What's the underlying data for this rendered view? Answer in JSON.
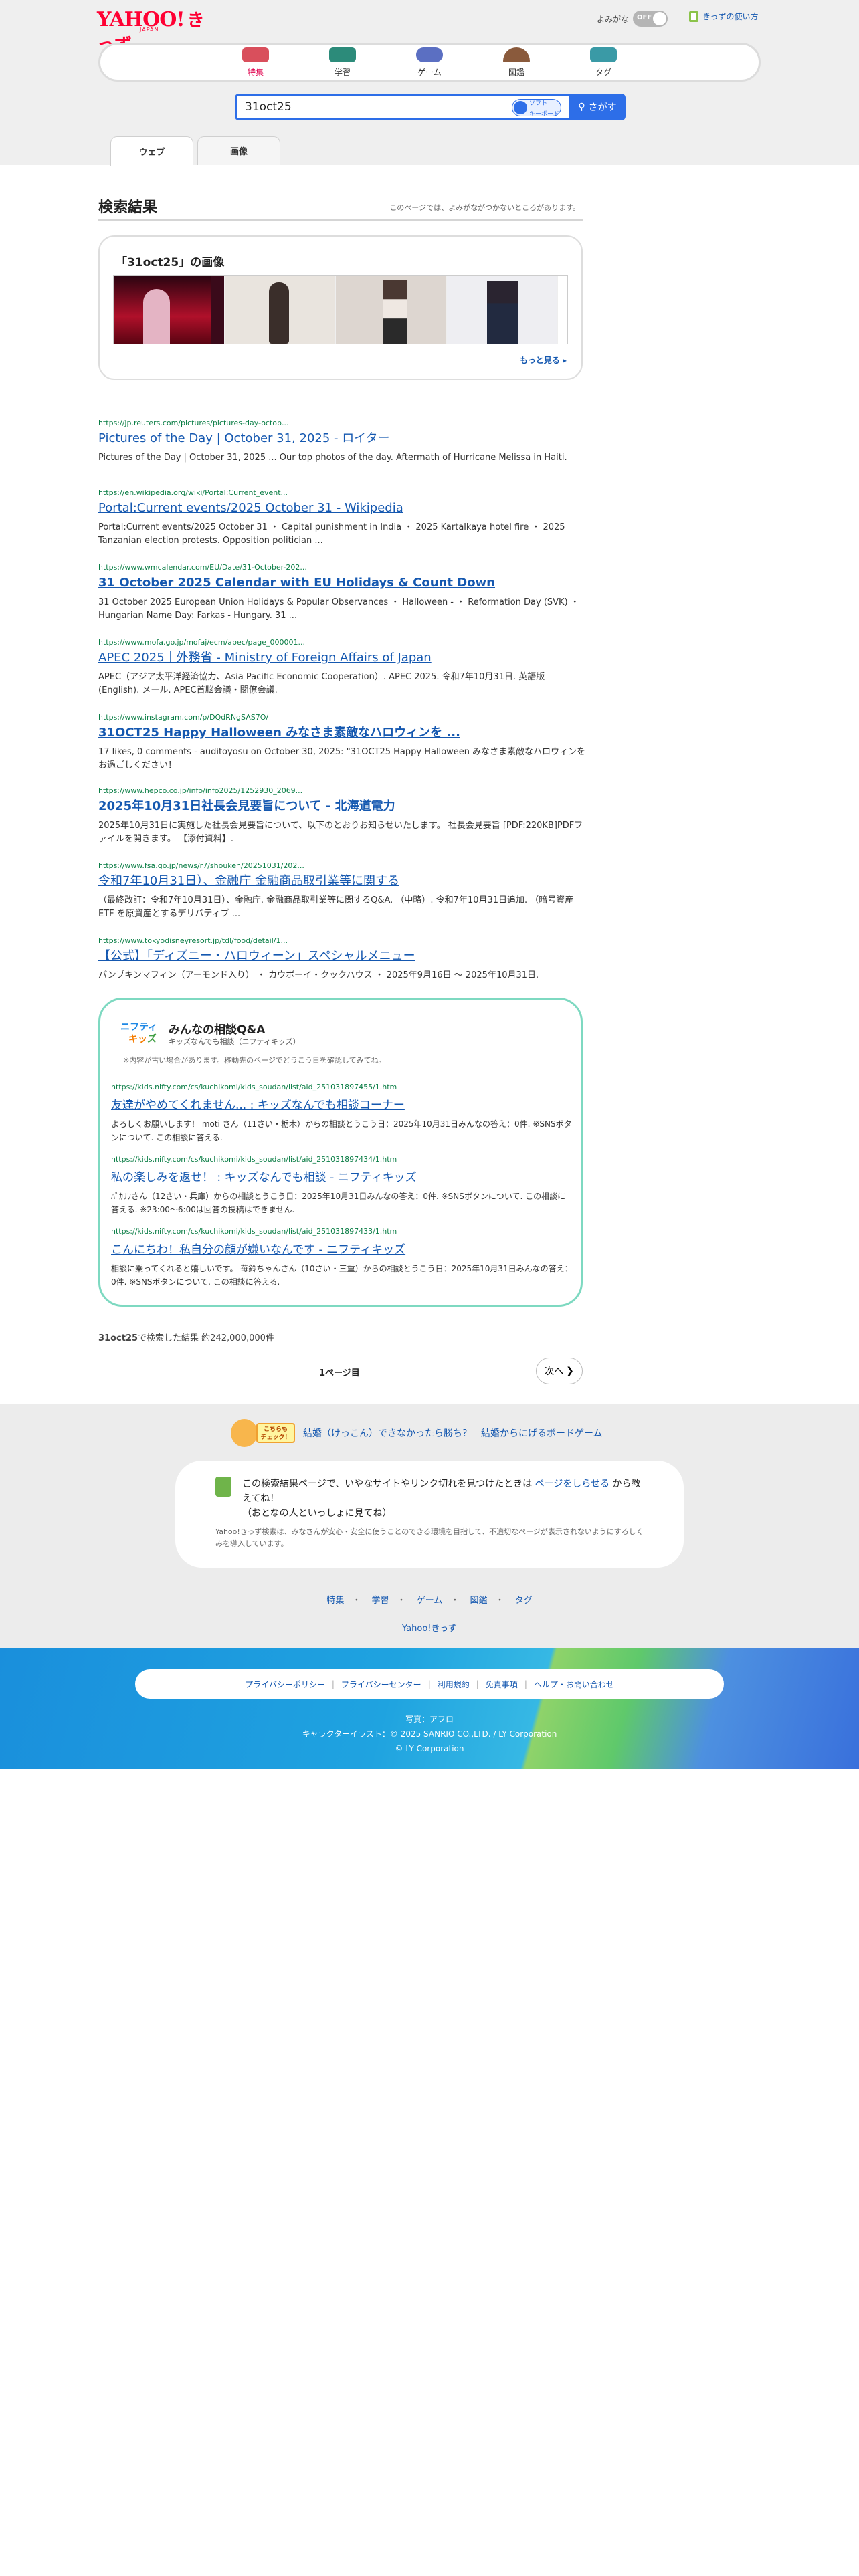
{
  "header": {
    "logo_yahoo": "YAHOO!",
    "logo_kids": "きっず",
    "logo_japan": "JAPAN",
    "yomigana_label": "よみがな",
    "toggle_state": "OFF",
    "howto_label": "きっずの使い方"
  },
  "categories": [
    {
      "label": "特集",
      "color": "#d94f5c"
    },
    {
      "label": "学習",
      "color": "#2c8b7a"
    },
    {
      "label": "ゲーム",
      "color": "#5b6fc2"
    },
    {
      "label": "図鑑",
      "color": "#8a5a3c"
    },
    {
      "label": "タグ",
      "color": "#3a9aa6"
    }
  ],
  "search": {
    "query": "31oct25",
    "keyboard_label_1": "ソフト",
    "keyboard_label_2": "キーボード",
    "button_label": "さがす"
  },
  "tabs": [
    {
      "label": "ウェブ",
      "active": true
    },
    {
      "label": "画像",
      "active": false
    }
  ],
  "results_header": {
    "title": "検索結果",
    "note": "このページでは、よみがながつかないところがあります。"
  },
  "image_box": {
    "title": "「31oct25」の画像",
    "more_label": "もっと見る"
  },
  "results": [
    {
      "url": "https://jp.reuters.com/pictures/pictures-day-octob...",
      "title": "Pictures of the Day | October 31, 2025 - ロイター",
      "snippet": "Pictures of the Day | October 31, 2025 ... Our top photos of the day. Aftermath of Hurricane Melissa in Haiti."
    },
    {
      "url": "https://en.wikipedia.org/wiki/Portal:Current_event...",
      "title": "Portal:Current events/2025 October 31 - Wikipedia",
      "snippet": "Portal:Current events/2025 October 31 ・ Capital punishment in India ・ 2025 Kartalkaya hotel fire ・ 2025 Tanzanian election protests. Opposition politician ..."
    },
    {
      "url": "https://www.wmcalendar.com/EU/Date/31-October-202...",
      "title": "31 October 2025 Calendar with EU Holidays & Count Down",
      "snippet": "31 October 2025 European Union Holidays & Popular Observances ・ Halloween - ・ Reformation Day (SVK) ・ Hungarian Name Day: Farkas - Hungary. 31 ..."
    },
    {
      "url": "https://www.mofa.go.jp/mofaj/ecm/apec/page_000001...",
      "title": "APEC 2025｜外務省 - Ministry of Foreign Affairs of Japan",
      "snippet": "APEC（アジア太平洋経済協力、Asia Pacific Economic Cooperation）. APEC 2025. 令和7年10月31日. 英語版 (English). メール. APEC首脳会議・閣僚会議."
    },
    {
      "url": "https://www.instagram.com/p/DQdRNgSAS7O/",
      "title": "31OCT25 Happy Halloween みなさま素敵なハロウィンを ...",
      "snippet": "17 likes, 0 comments - auditoyosu on October 30, 2025: \"31OCT25 Happy Halloween みなさま素敵なハロウィンをお過ごしください！"
    },
    {
      "url": "https://www.hepco.co.jp/info/info2025/1252930_2069...",
      "title": "2025年10月31日社長会見要旨について - 北海道電力",
      "snippet": "2025年10月31日に実施した社長会見要旨について、以下のとおりお知らせいたします。 社長会見要旨 [PDF:220KB]PDFファイルを開きます。 【添付資料】."
    },
    {
      "url": "https://www.fsa.go.jp/news/r7/shouken/20251031/202...",
      "title": "令和7年10月31日）、金融庁 金融商品取引業等に関する",
      "snippet": "（最終改訂：令和7年10月31日）、金融庁. 金融商品取引業等に関するQ&A. （中略）. 令和7年10月31日追加. （暗号資産 ETF を原資産とするデリバティブ ..."
    },
    {
      "url": "https://www.tokyodisneyresort.jp/tdl/food/detail/1...",
      "title": "【公式】「ディズニー・ハロウィーン」スペシャルメニュー",
      "snippet": "パンプキンマフィン（アーモンド入り） ・ カウボーイ・クックハウス ・ 2025年9月16日 〜 2025年10月31日."
    }
  ],
  "qa": {
    "brand_1": "ニフティ",
    "brand_2a": "キッ",
    "brand_2b": "ズ",
    "title": "みんなの相談Q&A",
    "subtitle": "キッズなんでも相談（ニフティキッズ）",
    "note": "※内容が古い場合があります。移動先のページでどうこう日を確認してみてね。",
    "items": [
      {
        "url": "https://kids.nifty.com/cs/kuchikomi/kids_soudan/list/aid_251031897455/1.htm",
        "title": "友達がやめてくれません... : キッズなんでも相談コーナー",
        "snippet": "よろしくお願いします！ moti さん（11さい・栃木）からの相談とうこう日：2025年10月31日みんなの答え：0件. ※SNSボタンについて. この相談に答える."
      },
      {
        "url": "https://kids.nifty.com/cs/kuchikomi/kids_soudan/list/aid_251031897434/1.htm",
        "title": "私の楽しみを返せ！ : キッズなんでも相談 - ニフティキッズ",
        "snippet": "ﾊﾞｶﾘﾌさん（12さい・兵庫）からの相談とうこう日：2025年10月31日みんなの答え：0件. ※SNSボタンについて. この相談に答える. ※23:00〜6:00は回答の投稿はできません."
      },
      {
        "url": "https://kids.nifty.com/cs/kuchikomi/kids_soudan/list/aid_251031897433/1.htm",
        "title": "こんにちわ！私自分の顔が嫌いなんです - ニフティキッズ",
        "snippet": "相談に乗ってくれると嬉しいです。 苺鈴ちゃんさん（10さい・三重）からの相談とうこう日：2025年10月31日みんなの答え：0件. ※SNSボタンについて. この相談に答える."
      }
    ]
  },
  "count": {
    "query": "31oct25",
    "text": "で検索した結果 約242,000,000件"
  },
  "pager": {
    "page_label": "1ページ目",
    "next_label": "次へ"
  },
  "promo": {
    "badge_1": "こちらも",
    "badge_2": "チェック！",
    "link": "結婚（けっこん）できなかったら勝ち？　結婚からにげるボードゲーム"
  },
  "report": {
    "text_1": "この検索結果ページで、いやなサイトやリンク切れを見つけたときは",
    "link": "ページをしらせる",
    "text_2": "から教えてね！",
    "text_3": "（おとなの人といっしょに見てね）",
    "small": "Yahoo!きっず検索は、みなさんが安心・安全に使うことのできる環境を目指して、不適切なページが表示されないようにするしくみを導入しています。"
  },
  "footer_links": [
    "特集",
    "学習",
    "ゲーム",
    "図鑑",
    "タグ"
  ],
  "footer_home": "Yahoo!きっず",
  "policy_links": [
    "プライバシーポリシー",
    "プライバシーセンター",
    "利用規約",
    "免責事項",
    "ヘルプ・お問い合わせ"
  ],
  "credits": {
    "line1": "写真：アフロ",
    "line2": "キャラクターイラスト：© 2025 SANRIO CO.,LTD. / LY Corporation",
    "line3": "© LY Corporation"
  }
}
